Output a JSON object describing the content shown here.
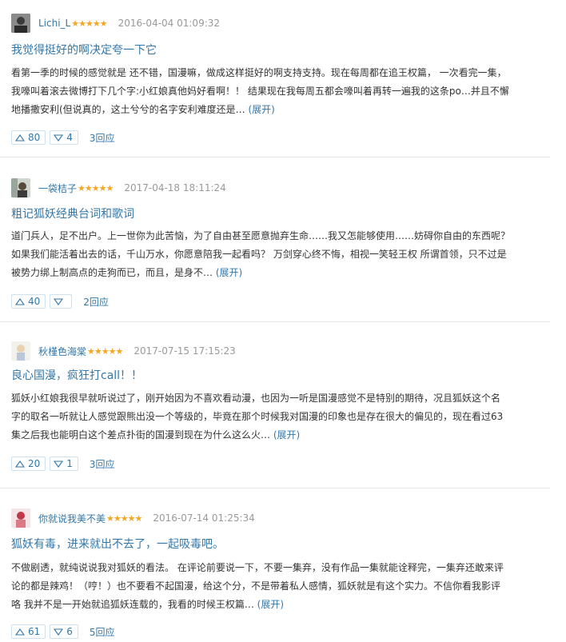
{
  "reviews": [
    {
      "user": "Lichi_L",
      "stars": "★★★★★",
      "time": "2016-04-04 01:09:32",
      "title": "我觉得挺好的啊决定夸一下它",
      "lines": [
        "看第一季的时候的感觉就是 还不错，国漫嘛，做成这样挺好的啊支持支持。现在每周都在追王权篇， 一次看完一集，",
        "我嚎叫着滚去微博打下几个字:小红娘真他妈好看啊！！ 结果现在我每周五都会嚎叫着再转一遍我的这条po…并且不懈",
        "地播撒安利(但说真的，这土兮兮的名字安利难度还是… "
      ],
      "expand": "(展开)",
      "up": "80",
      "down": "4",
      "replies": "3回应"
    },
    {
      "user": "一袋桔子",
      "stars": "★★★★★",
      "time": "2017-04-18 18:11:24",
      "title": "粗记狐妖经典台词和歌词",
      "lines": [
        "道门兵人，足不出户。上一世你为此苦恼，为了自由甚至愿意抛弃生命……我又怎能够使用……妨碍你自由的东西呢？",
        "如果我们能活着出去的话，千山万水，你愿意陪我一起看吗？ 万剑穿心终不悔，相视一笑轻王权 所谓首领，只不过是",
        "被势力绑上制高点的走狗而已，而且，是身不… "
      ],
      "expand": "(展开)",
      "up": "40",
      "down": "",
      "replies": "2回应"
    },
    {
      "user": "秋槿色海棠",
      "stars": "★★★★★",
      "time": "2017-07-15 17:15:23",
      "title": "良心国漫，疯狂打call！！",
      "lines": [
        "狐妖小红娘我很早就听说过了，刚开始因为不喜欢看动漫，也因为一听是国漫感觉不是特别的期待，况且狐妖这个名",
        "字的取名一听就让人感觉跟熊出没一个等级的，毕竟在那个时候我对国漫的印象也是存在很大的偏见的，现在看过63",
        "集之后我也能明白这个差点扑街的国漫到现在为什么这么火… "
      ],
      "expand": "(展开)",
      "up": "20",
      "down": "1",
      "replies": "3回应"
    },
    {
      "user": "你就说我美不美",
      "stars": "★★★★★",
      "time": "2016-07-14 01:25:34",
      "title": "狐妖有毒，进来就出不去了，一起吸毒吧。",
      "lines": [
        "不做剧透，就纯说说我对狐妖的看法。 在评论前要说一下，不要一集弃，没有作品一集就能诠释完，一集弃还敢来评",
        "论的都是辣鸡！（哼！）也不要看不起国漫，给这个分，不是带着私人感情，狐妖就是有这个实力。不信你看我影评",
        "咯 我并不是一开始就追狐妖连载的，我看的时候王权篇… "
      ],
      "expand": "(展开)",
      "up": "61",
      "down": "6",
      "replies": "5回应"
    }
  ]
}
